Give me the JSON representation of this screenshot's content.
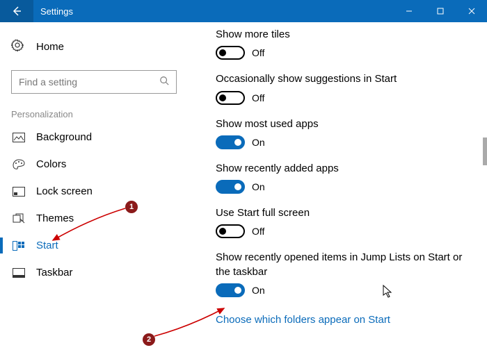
{
  "titlebar": {
    "title": "Settings"
  },
  "sidebar": {
    "home_label": "Home",
    "search_placeholder": "Find a setting",
    "section_label": "Personalization",
    "items": [
      {
        "label": "Background"
      },
      {
        "label": "Colors"
      },
      {
        "label": "Lock screen"
      },
      {
        "label": "Themes"
      },
      {
        "label": "Start"
      },
      {
        "label": "Taskbar"
      }
    ]
  },
  "content": {
    "settings": [
      {
        "title": "Show more tiles",
        "state": "off",
        "state_label": "Off"
      },
      {
        "title": "Occasionally show suggestions in Start",
        "state": "off",
        "state_label": "Off"
      },
      {
        "title": "Show most used apps",
        "state": "on",
        "state_label": "On"
      },
      {
        "title": "Show recently added apps",
        "state": "on",
        "state_label": "On"
      },
      {
        "title": "Use Start full screen",
        "state": "off",
        "state_label": "Off"
      },
      {
        "title": "Show recently opened items in Jump Lists on Start or the taskbar",
        "state": "on",
        "state_label": "On"
      }
    ],
    "link_text": "Choose which folders appear on Start"
  },
  "annotations": {
    "badge1": "1",
    "badge2": "2"
  }
}
